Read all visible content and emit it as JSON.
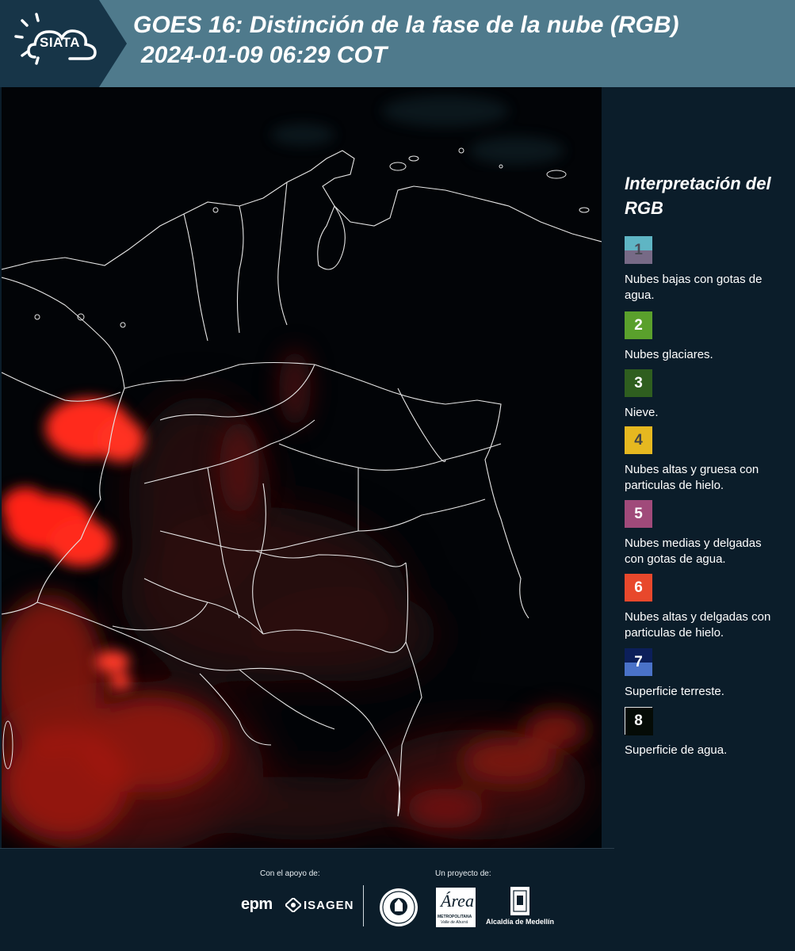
{
  "header": {
    "logo_text": "SIATA",
    "title": "GOES 16: Distinción de la fase de la nube (RGB)",
    "subtitle": "2024-01-09 06:29 COT"
  },
  "legend": {
    "title": "Interpretación del RGB",
    "items": [
      {
        "num": "1",
        "label": "Nubes bajas con gotas de agua.",
        "color_top": "#5fb5c4",
        "color_bottom": "#776a86",
        "num_color": "#4a4a55"
      },
      {
        "num": "2",
        "label": "Nubes glaciares.",
        "color_top": "#5aa02c",
        "color_bottom": "#5aa02c",
        "num_color": "#ffffff"
      },
      {
        "num": "3",
        "label": "Nieve.",
        "color_top": "#2f5e1f",
        "color_bottom": "#2f5e1f",
        "num_color": "#ffffff"
      },
      {
        "num": "4",
        "label": "Nubes altas y gruesa con particulas de hielo.",
        "color_top": "#e6b820",
        "color_bottom": "#e6b820",
        "num_color": "#444444"
      },
      {
        "num": "5",
        "label": "Nubes medias y delgadas con gotas de agua.",
        "color_top": "#a04a7a",
        "color_bottom": "#a04a7a",
        "num_color": "#ffffff"
      },
      {
        "num": "6",
        "label": "Nubes altas y delgadas con particulas de hielo.",
        "color_top": "#e8482c",
        "color_bottom": "#e8482c",
        "num_color": "#ffffff"
      },
      {
        "num": "7",
        "label": "Superficie terreste.",
        "color_top": "#0c1f5a",
        "color_bottom": "#4a72c8",
        "num_color": "#ffffff"
      },
      {
        "num": "8",
        "label": "Superficie de agua.",
        "color_top": "#050b06",
        "color_bottom": "#050b06",
        "num_color": "#ffffff"
      }
    ]
  },
  "footer": {
    "support_label": "Con el apoyo de:",
    "project_label": "Un proyecto de:",
    "sponsor_1": "epm",
    "sponsor_2": "ISAGEN",
    "area_logo_letter": "Área",
    "area_logo_name": "METROPOLITANA",
    "area_logo_sub": "Valle de Aburrá",
    "alcaldia": "Alcaldía de Medellín"
  },
  "colors": {
    "header_bg": "#4f7a8c",
    "panel_bg": "#0b1d2a",
    "map_bg": "#020407",
    "cloud_red": "#ff2a1a"
  }
}
